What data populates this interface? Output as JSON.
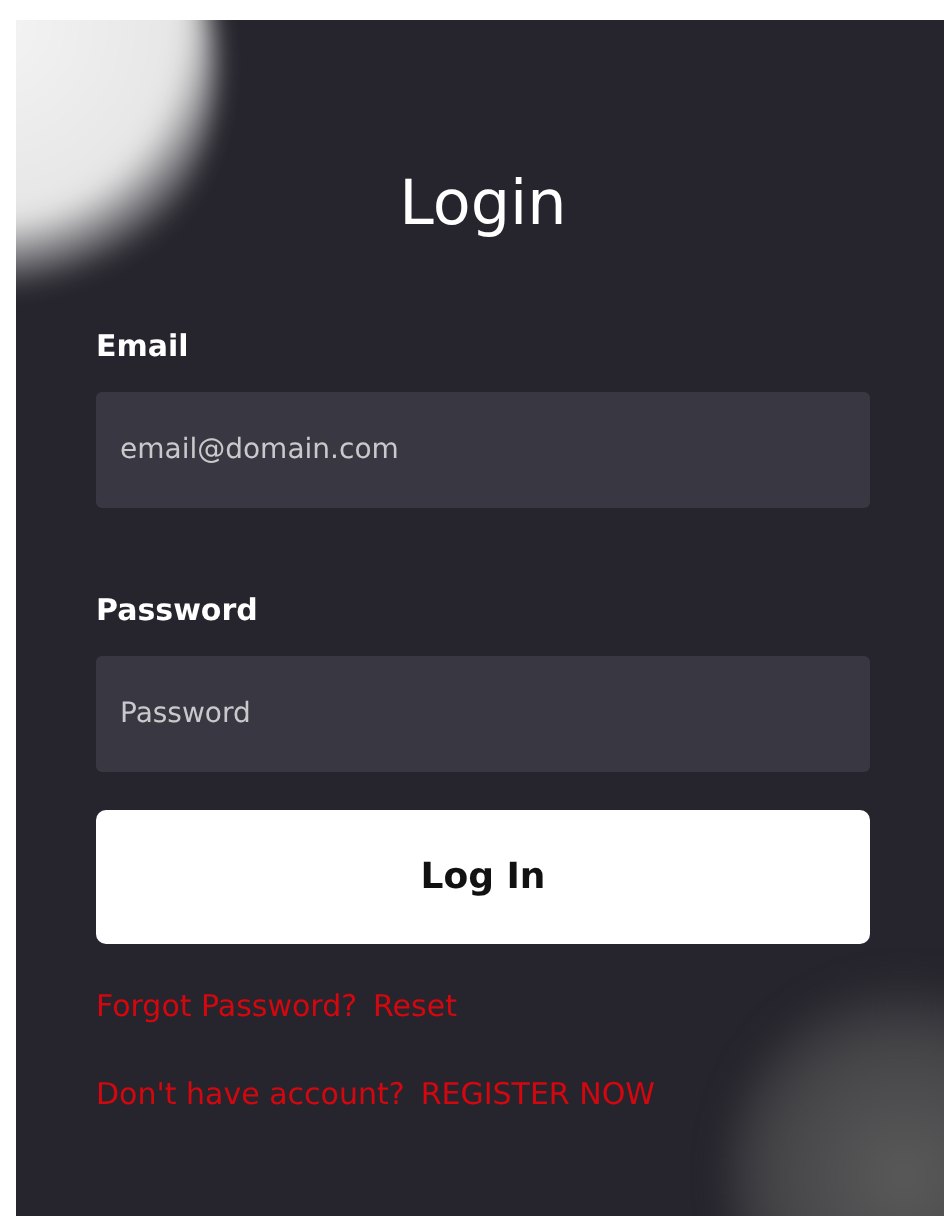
{
  "title": "Login",
  "fields": [
    {
      "label": "Email",
      "placeholder": "email@domain.com"
    },
    {
      "label": "Password",
      "placeholder": "Password"
    }
  ],
  "submit_button": "Log In",
  "links": [
    {
      "prompt": "Forgot Password?",
      "action": "Reset"
    },
    {
      "prompt": "Don't have account?",
      "action": "REGISTER NOW"
    }
  ]
}
